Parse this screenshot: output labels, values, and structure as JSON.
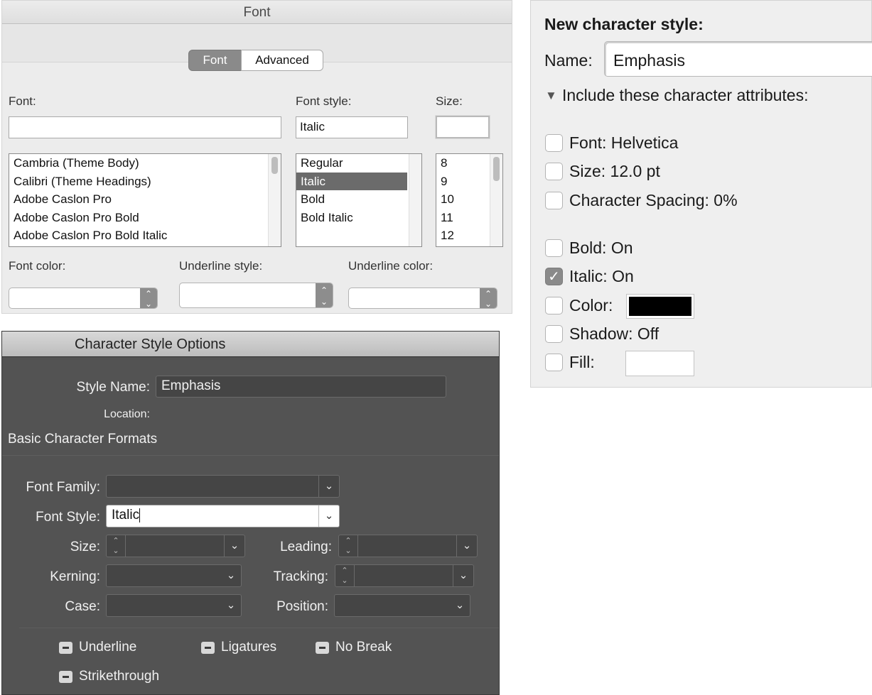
{
  "font_dialog": {
    "title": "Font",
    "tabs": [
      "Font",
      "Advanced"
    ],
    "active_tab": "Font",
    "font_label": "Font:",
    "font_value": "",
    "font_style_label": "Font style:",
    "font_style_value": "Italic",
    "size_label": "Size:",
    "size_value": "",
    "font_list": [
      "Cambria (Theme Body)",
      "Calibri (Theme Headings)",
      "Adobe Caslon Pro",
      "Adobe Caslon Pro Bold",
      "Adobe Caslon Pro Bold Italic"
    ],
    "style_list": [
      "Regular",
      "Italic",
      "Bold",
      "Bold Italic"
    ],
    "style_selected": "Italic",
    "size_list": [
      "8",
      "9",
      "10",
      "11",
      "12"
    ],
    "font_color_label": "Font color:",
    "underline_style_label": "Underline style:",
    "underline_color_label": "Underline color:"
  },
  "new_character_style": {
    "heading": "New character style:",
    "name_label": "Name:",
    "name_value": "Emphasis",
    "include_label": "Include these character attributes:",
    "attributes": [
      {
        "label": "Font:  Helvetica",
        "checked": false
      },
      {
        "label": "Size:  12.0 pt",
        "checked": false
      },
      {
        "label": "Character Spacing:  0%",
        "checked": false
      },
      {
        "label": "Bold:  On",
        "checked": false
      },
      {
        "label": "Italic:  On",
        "checked": true
      },
      {
        "label": "Color:",
        "checked": false,
        "swatch": "#000000"
      },
      {
        "label": "Shadow: Off",
        "checked": false
      },
      {
        "label": "Fill:",
        "checked": false,
        "swatch": "#ffffff"
      }
    ]
  },
  "character_style_options": {
    "title": "Character Style Options",
    "style_name_label": "Style Name:",
    "style_name_value": "Emphasis",
    "location_label": "Location:",
    "section_title": "Basic Character Formats",
    "font_family_label": "Font Family:",
    "font_family_value": "",
    "font_style_label": "Font Style:",
    "font_style_value": "Italic",
    "size_label": "Size:",
    "leading_label": "Leading:",
    "kerning_label": "Kerning:",
    "tracking_label": "Tracking:",
    "case_label": "Case:",
    "position_label": "Position:",
    "options": [
      "Underline",
      "Ligatures",
      "No Break",
      "Strikethrough"
    ]
  }
}
